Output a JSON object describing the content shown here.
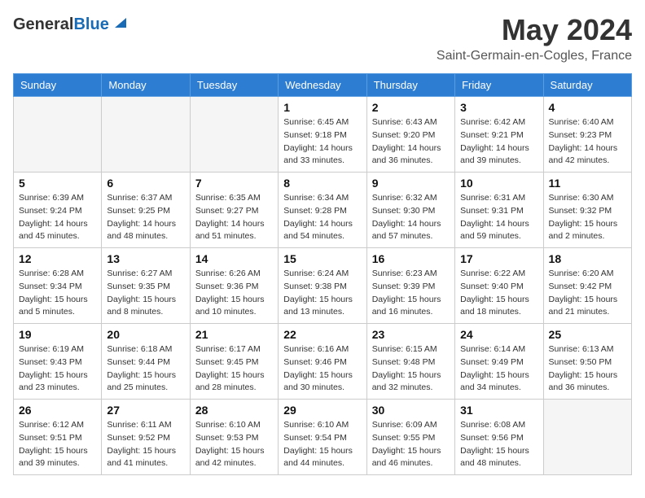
{
  "header": {
    "logo_general": "General",
    "logo_blue": "Blue",
    "month_title": "May 2024",
    "location": "Saint-Germain-en-Cogles, France"
  },
  "days_of_week": [
    "Sunday",
    "Monday",
    "Tuesday",
    "Wednesday",
    "Thursday",
    "Friday",
    "Saturday"
  ],
  "weeks": [
    [
      {
        "day": "",
        "info": ""
      },
      {
        "day": "",
        "info": ""
      },
      {
        "day": "",
        "info": ""
      },
      {
        "day": "1",
        "info": "Sunrise: 6:45 AM\nSunset: 9:18 PM\nDaylight: 14 hours\nand 33 minutes."
      },
      {
        "day": "2",
        "info": "Sunrise: 6:43 AM\nSunset: 9:20 PM\nDaylight: 14 hours\nand 36 minutes."
      },
      {
        "day": "3",
        "info": "Sunrise: 6:42 AM\nSunset: 9:21 PM\nDaylight: 14 hours\nand 39 minutes."
      },
      {
        "day": "4",
        "info": "Sunrise: 6:40 AM\nSunset: 9:23 PM\nDaylight: 14 hours\nand 42 minutes."
      }
    ],
    [
      {
        "day": "5",
        "info": "Sunrise: 6:39 AM\nSunset: 9:24 PM\nDaylight: 14 hours\nand 45 minutes."
      },
      {
        "day": "6",
        "info": "Sunrise: 6:37 AM\nSunset: 9:25 PM\nDaylight: 14 hours\nand 48 minutes."
      },
      {
        "day": "7",
        "info": "Sunrise: 6:35 AM\nSunset: 9:27 PM\nDaylight: 14 hours\nand 51 minutes."
      },
      {
        "day": "8",
        "info": "Sunrise: 6:34 AM\nSunset: 9:28 PM\nDaylight: 14 hours\nand 54 minutes."
      },
      {
        "day": "9",
        "info": "Sunrise: 6:32 AM\nSunset: 9:30 PM\nDaylight: 14 hours\nand 57 minutes."
      },
      {
        "day": "10",
        "info": "Sunrise: 6:31 AM\nSunset: 9:31 PM\nDaylight: 14 hours\nand 59 minutes."
      },
      {
        "day": "11",
        "info": "Sunrise: 6:30 AM\nSunset: 9:32 PM\nDaylight: 15 hours\nand 2 minutes."
      }
    ],
    [
      {
        "day": "12",
        "info": "Sunrise: 6:28 AM\nSunset: 9:34 PM\nDaylight: 15 hours\nand 5 minutes."
      },
      {
        "day": "13",
        "info": "Sunrise: 6:27 AM\nSunset: 9:35 PM\nDaylight: 15 hours\nand 8 minutes."
      },
      {
        "day": "14",
        "info": "Sunrise: 6:26 AM\nSunset: 9:36 PM\nDaylight: 15 hours\nand 10 minutes."
      },
      {
        "day": "15",
        "info": "Sunrise: 6:24 AM\nSunset: 9:38 PM\nDaylight: 15 hours\nand 13 minutes."
      },
      {
        "day": "16",
        "info": "Sunrise: 6:23 AM\nSunset: 9:39 PM\nDaylight: 15 hours\nand 16 minutes."
      },
      {
        "day": "17",
        "info": "Sunrise: 6:22 AM\nSunset: 9:40 PM\nDaylight: 15 hours\nand 18 minutes."
      },
      {
        "day": "18",
        "info": "Sunrise: 6:20 AM\nSunset: 9:42 PM\nDaylight: 15 hours\nand 21 minutes."
      }
    ],
    [
      {
        "day": "19",
        "info": "Sunrise: 6:19 AM\nSunset: 9:43 PM\nDaylight: 15 hours\nand 23 minutes."
      },
      {
        "day": "20",
        "info": "Sunrise: 6:18 AM\nSunset: 9:44 PM\nDaylight: 15 hours\nand 25 minutes."
      },
      {
        "day": "21",
        "info": "Sunrise: 6:17 AM\nSunset: 9:45 PM\nDaylight: 15 hours\nand 28 minutes."
      },
      {
        "day": "22",
        "info": "Sunrise: 6:16 AM\nSunset: 9:46 PM\nDaylight: 15 hours\nand 30 minutes."
      },
      {
        "day": "23",
        "info": "Sunrise: 6:15 AM\nSunset: 9:48 PM\nDaylight: 15 hours\nand 32 minutes."
      },
      {
        "day": "24",
        "info": "Sunrise: 6:14 AM\nSunset: 9:49 PM\nDaylight: 15 hours\nand 34 minutes."
      },
      {
        "day": "25",
        "info": "Sunrise: 6:13 AM\nSunset: 9:50 PM\nDaylight: 15 hours\nand 36 minutes."
      }
    ],
    [
      {
        "day": "26",
        "info": "Sunrise: 6:12 AM\nSunset: 9:51 PM\nDaylight: 15 hours\nand 39 minutes."
      },
      {
        "day": "27",
        "info": "Sunrise: 6:11 AM\nSunset: 9:52 PM\nDaylight: 15 hours\nand 41 minutes."
      },
      {
        "day": "28",
        "info": "Sunrise: 6:10 AM\nSunset: 9:53 PM\nDaylight: 15 hours\nand 42 minutes."
      },
      {
        "day": "29",
        "info": "Sunrise: 6:10 AM\nSunset: 9:54 PM\nDaylight: 15 hours\nand 44 minutes."
      },
      {
        "day": "30",
        "info": "Sunrise: 6:09 AM\nSunset: 9:55 PM\nDaylight: 15 hours\nand 46 minutes."
      },
      {
        "day": "31",
        "info": "Sunrise: 6:08 AM\nSunset: 9:56 PM\nDaylight: 15 hours\nand 48 minutes."
      },
      {
        "day": "",
        "info": ""
      }
    ]
  ]
}
